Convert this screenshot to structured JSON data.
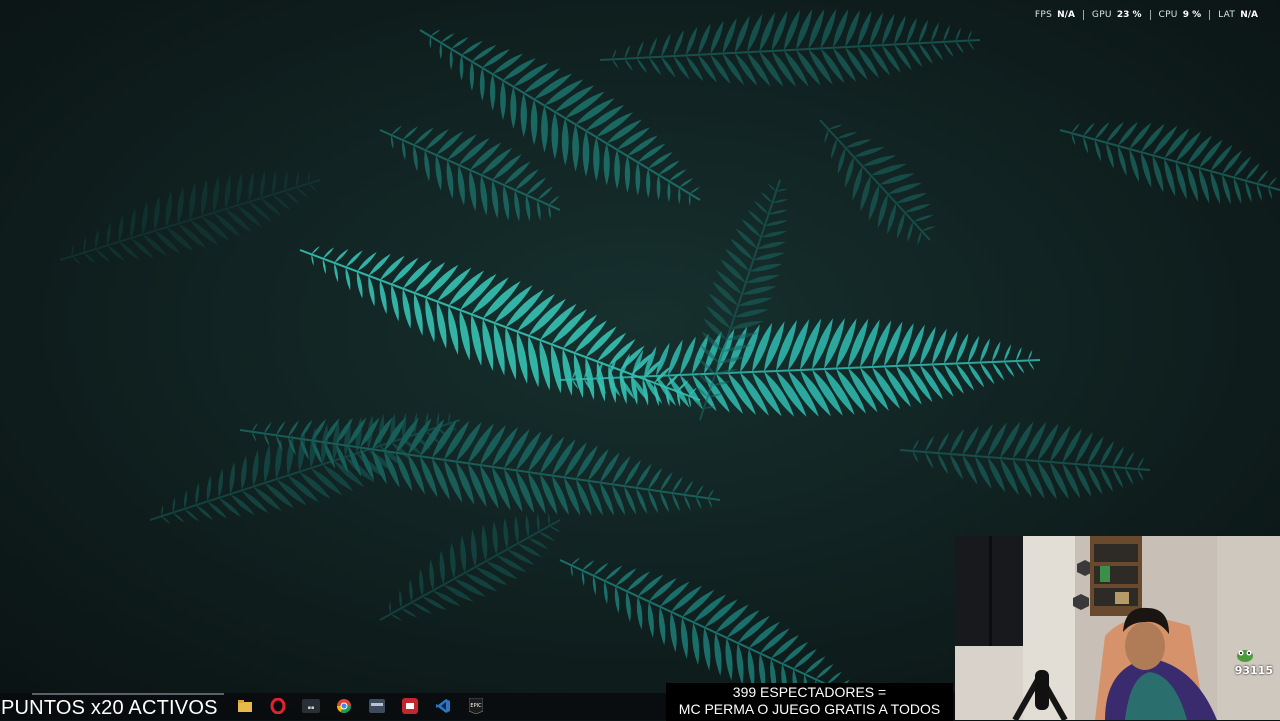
{
  "perf_overlay": {
    "metrics": [
      {
        "label": "FPS",
        "value": "N/A"
      },
      {
        "label": "GPU",
        "value": "23 %"
      },
      {
        "label": "CPU",
        "value": "9 %"
      },
      {
        "label": "LAT",
        "value": "N/A"
      }
    ]
  },
  "stream_overlay": {
    "points_text": "PUNTOS x20 ACTIVOS",
    "viewers_line1": "399 ESPECTADORES =",
    "viewers_line2": "MC PERMA O JUEGO GRATIS A TODOS",
    "webcam_counter": "93115"
  },
  "taskbar": {
    "icons": [
      {
        "name": "file-explorer-icon",
        "color": "#e8b84a"
      },
      {
        "name": "opera-icon",
        "color": "#e0242c"
      },
      {
        "name": "streamlabs-icon",
        "color": "#2a2f35"
      },
      {
        "name": "chrome-icon",
        "color": "#4a8a3c"
      },
      {
        "name": "app-window-icon",
        "color": "#3d4b5c"
      },
      {
        "name": "red-app-icon",
        "color": "#c4262e"
      },
      {
        "name": "vscode-icon",
        "color": "#2f74c0"
      },
      {
        "name": "epic-games-icon",
        "color": "#1b1b1b",
        "text": "EPIC"
      }
    ]
  }
}
